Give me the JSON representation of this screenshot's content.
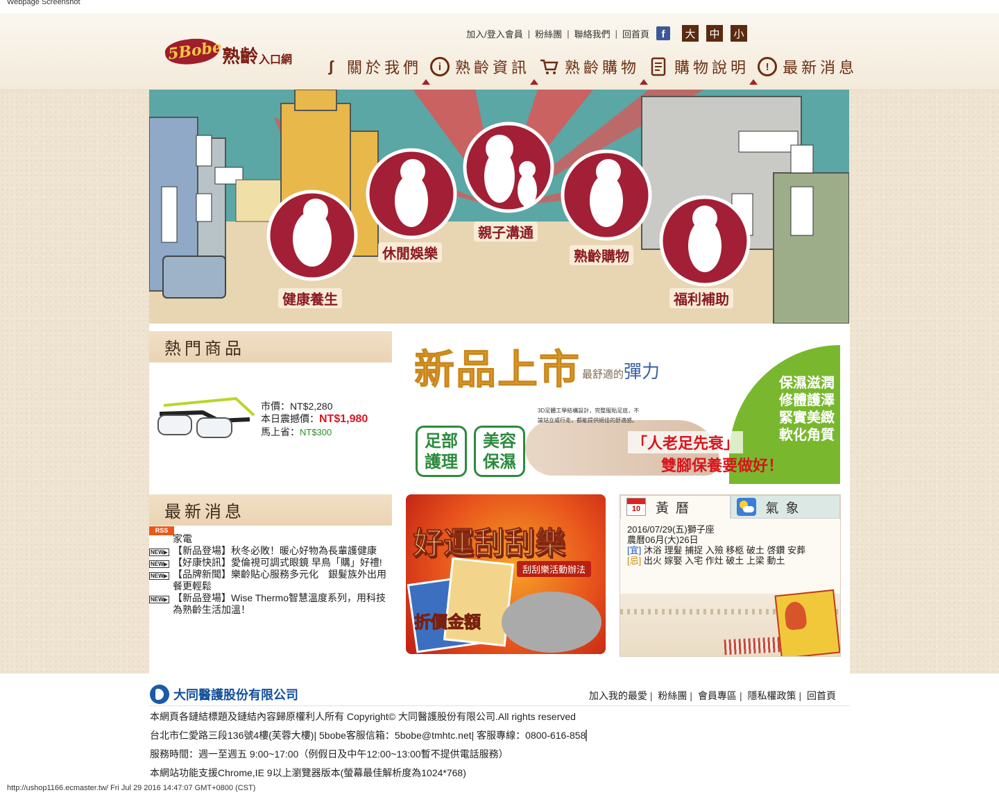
{
  "capture": {
    "top_caption": "Webpage Screenshot",
    "bottom_caption": "http://ushop1166.ecmaster.tw/ Fri Jul 29 2016 14:47:07 GMT+0800 (CST)"
  },
  "header": {
    "logo_mark": "5Bobe",
    "logo_title": "熟齡",
    "logo_sub": "入口網",
    "top_links": [
      "加入/登入會員",
      "粉絲團",
      "聯絡我們",
      "回首頁"
    ],
    "facebook_glyph": "f",
    "font_sizes": [
      "大",
      "中",
      "小"
    ],
    "nav": [
      {
        "label": "關於我們",
        "icon": "runner-icon"
      },
      {
        "label": "熟齡資訊",
        "icon": "info-circle-icon"
      },
      {
        "label": "熟齡購物",
        "icon": "cart-icon"
      },
      {
        "label": "購物說明",
        "icon": "document-icon"
      },
      {
        "label": "最新消息",
        "icon": "news-circle-icon"
      }
    ]
  },
  "banner": {
    "categories": [
      "健康養生",
      "休閒娛樂",
      "親子溝通",
      "熟齡購物",
      "福利補助"
    ]
  },
  "hot_products": {
    "heading": "熱門商品",
    "item": {
      "market_label": "市價：",
      "market_price": "NT$2,280",
      "today_label": "本日震撼價：",
      "today_price": "NT$1,980",
      "save_label": "馬上省：",
      "save_amount": "NT$300"
    }
  },
  "new_product_ad": {
    "title": "新品上市",
    "subtitle_prefix": "最舒適的",
    "subtitle_main": "彈力",
    "bullets": [
      "保濕滋潤",
      "修體護澤",
      "緊實美緻",
      "軟化角質"
    ],
    "small_text": "3D足體工學結構設計，完整服貼足底，不論站立或行走，都能提供絕佳的舒適感。",
    "badge1": "足部護理",
    "badge2": "美容保濕",
    "slogan1": "「人老足先衰」",
    "slogan2": "雙腳保養要做好！"
  },
  "latest_news": {
    "heading": "最新消息",
    "rss_label": "RSS",
    "new_label": "NEW▶",
    "partial_top": "家電",
    "items": [
      "【新品登場】秋冬必敗！暖心好物為長輩護健康",
      "【好康快訊】愛倫視可調式眼鏡 早鳥「購」好禮!",
      "【品牌新聞】樂齡貼心服務多元化　銀髮族外出用餐更輕鬆",
      "【新品登場】Wise Thermo智慧溫度系列，用科技為熟齡生活加溫！"
    ]
  },
  "lottery": {
    "title": "好運刮刮樂",
    "subtitle": "刮刮樂活動辦法",
    "discount_label": "折價金額"
  },
  "almanac": {
    "tab_almanac": "黃曆",
    "tab_weather": "氣象",
    "calendar_icon_number": "10",
    "date_line": "2016/07/29(五)獅子座",
    "lunar_line": "農曆06月(大)26日",
    "yi_label": "[宜]",
    "yi_text": "沐浴 理髮 捕捉 入殮 移柩 破土 啓鑽 安葬",
    "ji_label": "[忌]",
    "ji_text": "出火 嫁娶 入宅 作灶 破土 上梁 動土"
  },
  "footer": {
    "company_name": "大同醫護股份有限公司",
    "links": [
      "加入我的最愛",
      "粉絲團",
      "會員專區",
      "隱私權政策",
      "回首頁"
    ],
    "copyright": "本網頁各鏈結標題及鏈結內容歸原權利人所有 Copyright© 大同醫護股份有限公司.All rights reserved",
    "address": "台北市仁愛路三段136號4樓(芙蓉大樓)| 5bobe客服信箱：5bobe@tmhtc.net| 客服專線：0800-616-858▏",
    "hours": "服務時間：週一至週五 9:00~17:00（例假日及中午12:00~13:00暫不提供電話服務）",
    "browser": "本網站功能支援Chrome,IE 9以上瀏覽器版本(螢幕最佳解析度為1024*768)"
  }
}
